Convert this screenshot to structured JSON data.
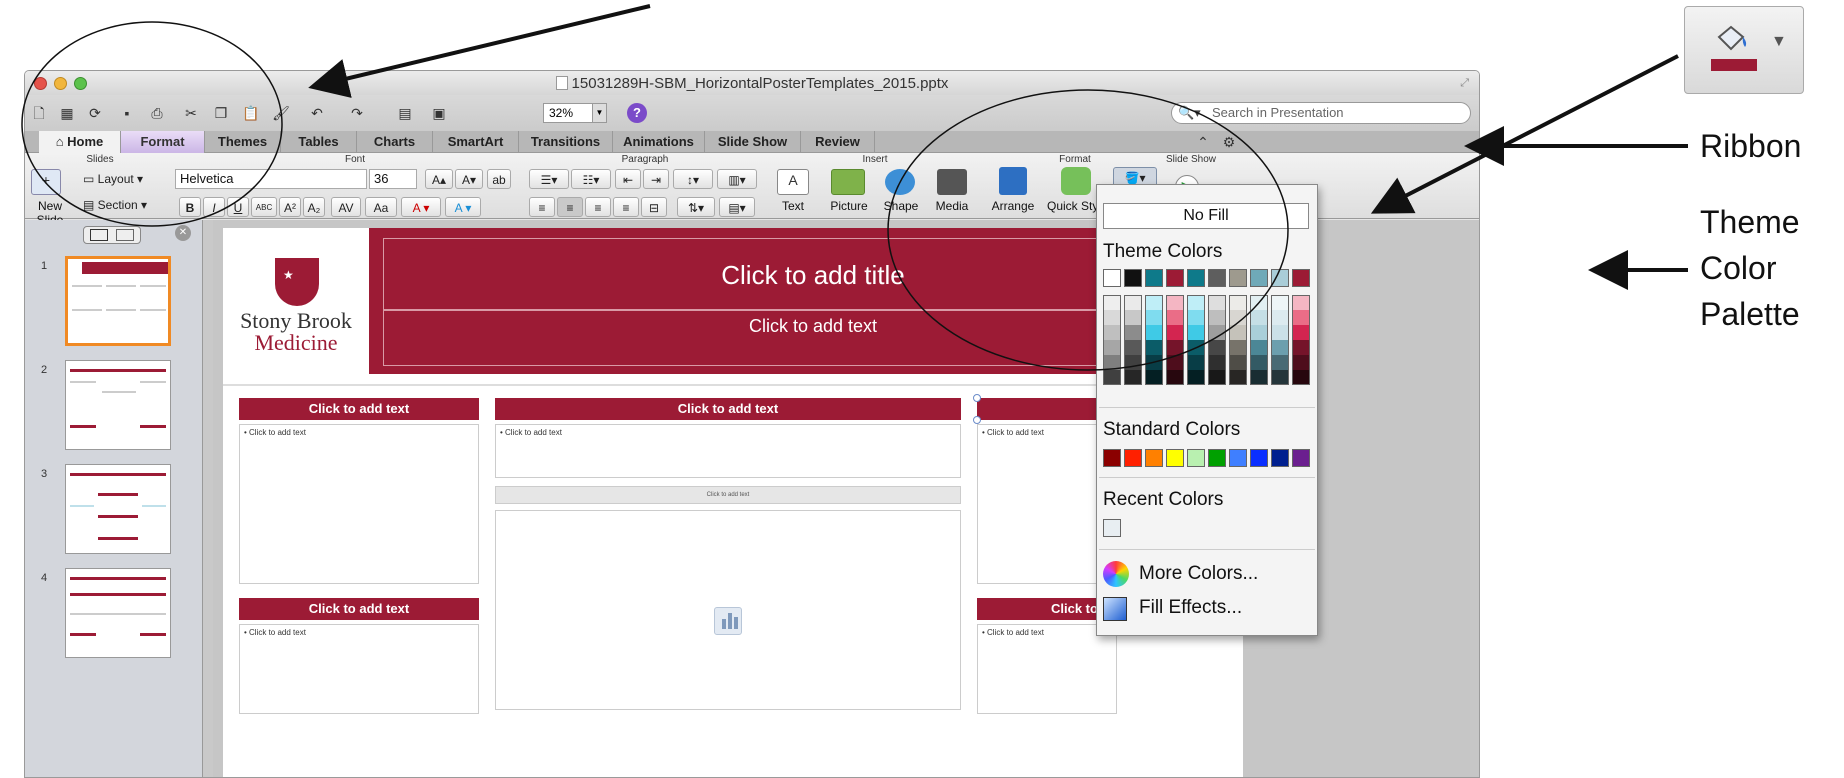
{
  "window": {
    "title": "15031289H-SBM_HorizontalPosterTemplates_2015.pptx"
  },
  "toolbar": {
    "zoom": "32%",
    "search_placeholder": "Search in Presentation"
  },
  "tabs": [
    "Home",
    "Format",
    "Themes",
    "Tables",
    "Charts",
    "SmartArt",
    "Transitions",
    "Animations",
    "Slide Show",
    "Review"
  ],
  "ribbon": {
    "groups": {
      "slides": "Slides",
      "font": "Font",
      "paragraph": "Paragraph",
      "insert": "Insert",
      "format": "Format",
      "slideshow": "Slide Show"
    },
    "new_slide": "New Slide",
    "layout": "Layout",
    "section": "Section",
    "font_name": "Helvetica",
    "font_size": "36",
    "insert_text": "Text",
    "insert_picture": "Picture",
    "insert_shape": "Shape",
    "insert_media": "Media",
    "arrange": "Arrange",
    "quick_styles": "Quick Sty"
  },
  "thumbnails": {
    "numbers": [
      "1",
      "2",
      "3",
      "4"
    ],
    "selected": 1
  },
  "slide": {
    "logo_line1": "Stony Brook",
    "logo_line2": "Medicine",
    "title_placeholder": "Click to add title",
    "subtitle_placeholder": "Click to add text",
    "col_heading": "Click to add text",
    "col_heading_clipped": "Click to",
    "bullet_text": "Click to add text",
    "small_placeholder": "Click to add text"
  },
  "dropdown": {
    "no_fill": "No Fill",
    "theme_colors_label": "Theme Colors",
    "theme_colors": [
      "#ffffff",
      "#111111",
      "#0e7a8a",
      "#9c1b35",
      "#0e7a8a",
      "#5e5e5e",
      "#9e9a8e",
      "#6fa9b8",
      "#a9cdd8",
      "#9c1b35"
    ],
    "theme_shades": [
      [
        "#eeeeee",
        "#d9d9d9",
        "#bfbfbf",
        "#a6a6a6",
        "#7f7f7f",
        "#404040"
      ],
      [
        "#eaeaea",
        "#c8c8c8",
        "#8c8c8c",
        "#595959",
        "#404040",
        "#262626"
      ],
      [
        "#bfeef7",
        "#7fdcef",
        "#3fcae6",
        "#0b5c68",
        "#083d46",
        "#041f23"
      ],
      [
        "#f4b6c3",
        "#ea6d87",
        "#d32550",
        "#75142a",
        "#4e0d1c",
        "#27070e"
      ],
      [
        "#bfeef7",
        "#7fdcef",
        "#3fcae6",
        "#0b5c68",
        "#083d46",
        "#041f23"
      ],
      [
        "#dedede",
        "#bebebe",
        "#9e9e9e",
        "#474747",
        "#2f2f2f",
        "#181818"
      ],
      [
        "#ecebe8",
        "#d8d6d1",
        "#c5c2ba",
        "#77736a",
        "#4f4d47",
        "#282624"
      ],
      [
        "#e2eff2",
        "#c5dfe6",
        "#a9cfd9",
        "#4c8796",
        "#335a64",
        "#192d32"
      ],
      [
        "#eef5f7",
        "#dcebf0",
        "#cbe1e8",
        "#6c9fae",
        "#486a74",
        "#24353a"
      ],
      [
        "#f4b6c3",
        "#ea6d87",
        "#d32550",
        "#75142a",
        "#4e0d1c",
        "#27070e"
      ]
    ],
    "standard_colors_label": "Standard Colors",
    "standard_colors": [
      "#8b0000",
      "#ff2000",
      "#ff8000",
      "#ffff00",
      "#b9f0b0",
      "#00a000",
      "#3f7fff",
      "#0a2fff",
      "#00208f",
      "#6b1f8f"
    ],
    "recent_colors_label": "Recent Colors",
    "recent_colors": [
      "#e8eef2"
    ],
    "more_colors": "More Colors...",
    "fill_effects": "Fill Effects..."
  },
  "annotations": {
    "ribbon": "Ribbon",
    "theme_color_palette": [
      "Theme",
      "Color",
      "Palette"
    ]
  }
}
